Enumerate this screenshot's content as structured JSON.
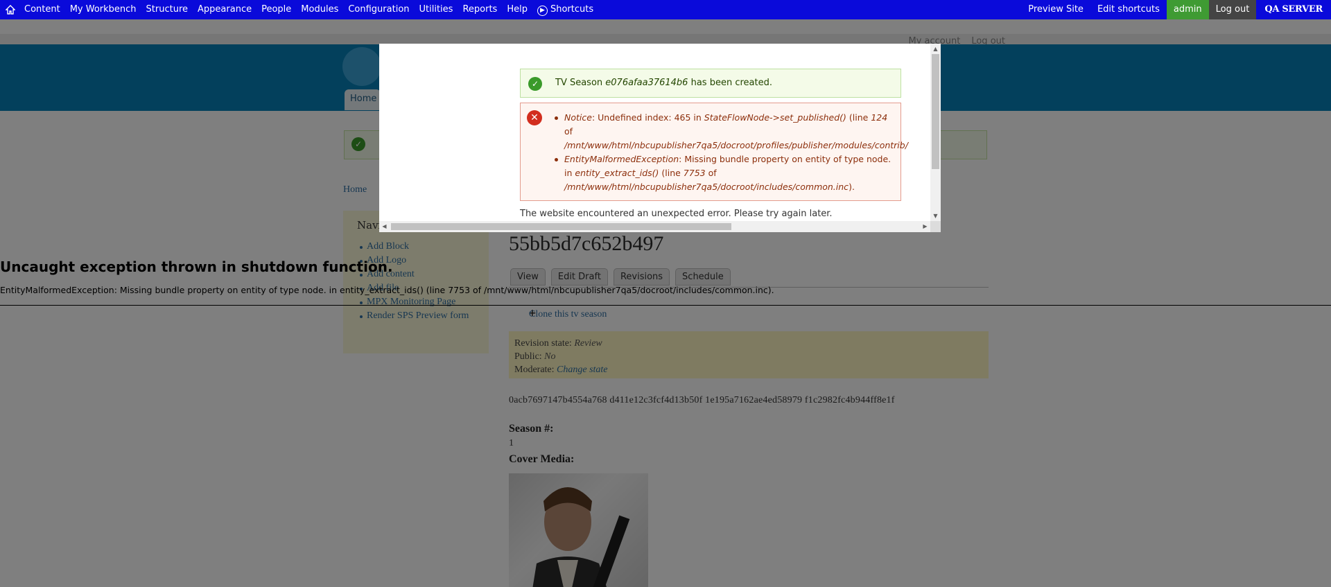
{
  "toolbar": {
    "home_icon": "home-icon",
    "items": [
      "Content",
      "My Workbench",
      "Structure",
      "Appearance",
      "People",
      "Modules",
      "Configuration",
      "Utilities",
      "Reports",
      "Help"
    ],
    "shortcuts_label": "Shortcuts",
    "shortcuts_icon": "chevron-right-circle-icon",
    "right": {
      "preview_site": "Preview Site",
      "edit_shortcuts": "Edit shortcuts",
      "admin": "admin",
      "logout": "Log out",
      "server": "QA SERVER"
    }
  },
  "site": {
    "user_links": [
      "My account",
      "Log out"
    ],
    "home_tab": "Home",
    "breadcrumb": "Home",
    "sidebar": {
      "title": "Navi",
      "items": [
        "Add Block",
        "Add Logo",
        "Add content",
        "Add file",
        "MPX Monitoring Page",
        "Render SPS Preview form"
      ]
    },
    "node_title": "55bb5d7c652b497",
    "tabs": [
      "View",
      "Edit Draft",
      "Revisions",
      "Schedule"
    ],
    "clone_link": "Clone this tv season",
    "revision": {
      "state_label": "Revision state:",
      "state_value": "Review",
      "public_label": "Public:",
      "public_value": "No",
      "moderate_label": "Moderate:",
      "moderate_link": "Change state"
    },
    "hash_text": "0acb7697147b4554a768 d411e12c3fcf4d13b50f 1e195a7162ae4ed58979 f1c2982fc4b944ff8e1f",
    "season_label": "Season #:",
    "season_value": "1",
    "cover_label": "Cover Media:"
  },
  "exception": {
    "title": "Uncaught exception thrown in shutdown function.",
    "body": "EntityMalformedException: Missing bundle property on entity of type node. in entity_extract_ids() (line 7753 of /mnt/www/html/nbcupublisher7qa5/docroot/includes/common.inc)."
  },
  "modal": {
    "status_prefix": "TV Season ",
    "status_name": "e076afaa37614b6",
    "status_suffix": " has been created.",
    "error1": {
      "type": "Notice",
      "msg": ": Undefined index: 465 in ",
      "func": "StateFlowNode->set_published()",
      "line_pre": " (line ",
      "line_num": "124",
      "of": "of",
      "path": "/mnt/www/html/nbcupublisher7qa5/docroot/profiles/publisher/modules/contrib/"
    },
    "error2": {
      "type": "EntityMalformedException",
      "msg": ": Missing bundle property on entity of type node.",
      "in": "in ",
      "func": "entity_extract_ids()",
      "line_pre": " (line ",
      "line_num": "7753",
      "of": " of",
      "path": "/mnt/www/html/nbcupublisher7qa5/docroot/includes/common.inc",
      "end": ")."
    },
    "error_text": "The website encountered an unexpected error. Please try again later."
  },
  "colors": {
    "toolbar_bg": "#0a0ada",
    "admin_bg": "#3f9b33",
    "logout_bg": "#444444",
    "status_green": "#3a9a2a",
    "error_red": "#d22d1e"
  }
}
